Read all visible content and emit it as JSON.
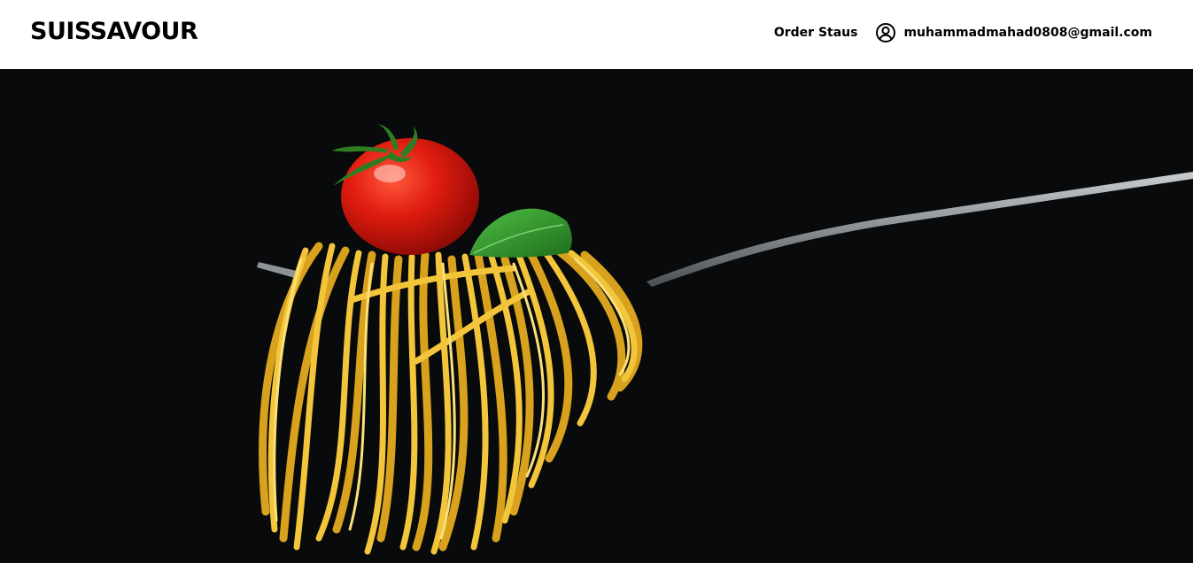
{
  "header": {
    "brand": "SUISSAVOUR",
    "nav": {
      "order_status_label": "Order Staus"
    },
    "user": {
      "email": "muhammadmahad0808@gmail.com",
      "icon": "user-circle-icon"
    }
  },
  "hero": {
    "image": "spaghetti-on-fork-with-cherry-tomato-and-basil-on-black",
    "colors": {
      "background": "#080a0b",
      "pasta": "#e8b630",
      "tomato": "#d8170f",
      "basil": "#2f9a2c"
    }
  }
}
